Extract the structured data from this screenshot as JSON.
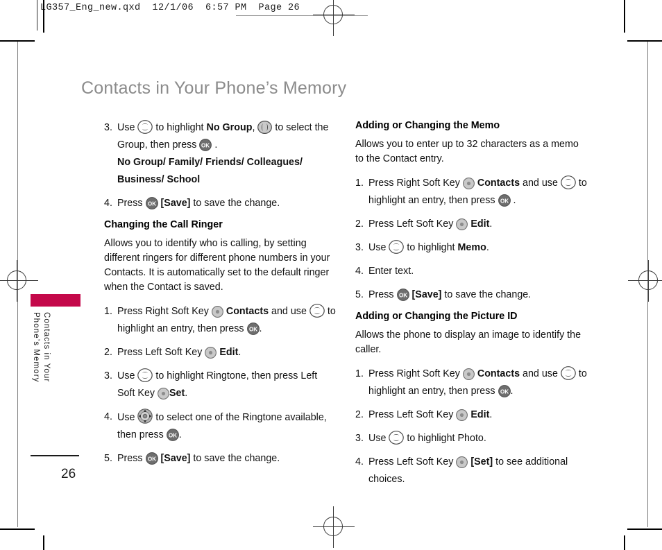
{
  "prepress": {
    "header_line": "LG357_Eng_new.qxd  12/1/06  6:57 PM  Page 26"
  },
  "page": {
    "title": "Contacts in Your Phone’s Memory",
    "side_tab_label": "Contacts in Your\nPhone’s Memory",
    "number": "26",
    "accent_color": "#c4084a"
  },
  "left_column": {
    "steps_group_continued": [
      {
        "num": "3.",
        "segments": [
          {
            "type": "text",
            "value": "Use "
          },
          {
            "type": "icon",
            "value": "updown-nav-icon"
          },
          {
            "type": "text",
            "value": " to highlight "
          },
          {
            "type": "bold",
            "value": "No Group"
          },
          {
            "type": "text",
            "value": ", "
          },
          {
            "type": "icon",
            "value": "leftright-nav-icon"
          },
          {
            "type": "text",
            "value": " to select the Group, then press "
          },
          {
            "type": "icon",
            "value": "ok-key-icon"
          },
          {
            "type": "text",
            "value": " ."
          }
        ],
        "sub_lines": [
          "No Group/ Family/ Friends/ Colleagues/",
          "Business/ School"
        ]
      },
      {
        "num": "4.",
        "segments": [
          {
            "type": "text",
            "value": "Press "
          },
          {
            "type": "icon",
            "value": "ok-key-icon"
          },
          {
            "type": "text",
            "value": " "
          },
          {
            "type": "bold",
            "value": "[Save]"
          },
          {
            "type": "text",
            "value": " to save the change."
          }
        ]
      }
    ],
    "section": {
      "heading": "Changing the Call Ringer",
      "paragraph": "Allows you to identify who is calling, by setting different ringers for different phone numbers in your Contacts. It is automatically set to the default ringer when the Contact is saved.",
      "steps": [
        {
          "num": "1.",
          "segments": [
            {
              "type": "text",
              "value": "Press Right Soft Key "
            },
            {
              "type": "icon",
              "value": "soft-key-icon"
            },
            {
              "type": "text",
              "value": " "
            },
            {
              "type": "bold",
              "value": "Contacts"
            },
            {
              "type": "text",
              "value": " and use "
            },
            {
              "type": "icon",
              "value": "updown-nav-icon"
            },
            {
              "type": "text",
              "value": " to highlight an entry, then press "
            },
            {
              "type": "icon",
              "value": "ok-key-icon"
            },
            {
              "type": "text",
              "value": "."
            }
          ]
        },
        {
          "num": "2.",
          "segments": [
            {
              "type": "text",
              "value": "Press Left Soft Key "
            },
            {
              "type": "icon",
              "value": "soft-key-icon"
            },
            {
              "type": "text",
              "value": " "
            },
            {
              "type": "bold",
              "value": "Edit"
            },
            {
              "type": "text",
              "value": "."
            }
          ]
        },
        {
          "num": "3.",
          "segments": [
            {
              "type": "text",
              "value": "Use "
            },
            {
              "type": "icon",
              "value": "updown-nav-icon"
            },
            {
              "type": "text",
              "value": " to highlight Ringtone, then press Left Soft Key "
            },
            {
              "type": "icon",
              "value": "soft-key-icon"
            },
            {
              "type": "bold",
              "value": "Set"
            },
            {
              "type": "text",
              "value": "."
            }
          ]
        },
        {
          "num": "4.",
          "segments": [
            {
              "type": "text",
              "value": "Use "
            },
            {
              "type": "icon",
              "value": "fourway-nav-icon"
            },
            {
              "type": "text",
              "value": " to select one of the Ringtone available, then press "
            },
            {
              "type": "icon",
              "value": "ok-key-icon"
            },
            {
              "type": "text",
              "value": "."
            }
          ]
        },
        {
          "num": "5.",
          "segments": [
            {
              "type": "text",
              "value": "Press "
            },
            {
              "type": "icon",
              "value": "ok-key-icon"
            },
            {
              "type": "text",
              "value": " "
            },
            {
              "type": "bold",
              "value": "[Save]"
            },
            {
              "type": "text",
              "value": " to save the change."
            }
          ]
        }
      ]
    }
  },
  "right_column": {
    "sections": [
      {
        "heading": "Adding or Changing the Memo",
        "paragraph": "Allows you to enter up to 32 characters as a memo to the Contact entry.",
        "steps": [
          {
            "num": "1.",
            "segments": [
              {
                "type": "text",
                "value": "Press Right Soft Key "
              },
              {
                "type": "icon",
                "value": "soft-key-icon"
              },
              {
                "type": "text",
                "value": " "
              },
              {
                "type": "bold",
                "value": "Contacts"
              },
              {
                "type": "text",
                "value": " and use "
              },
              {
                "type": "icon",
                "value": "updown-nav-icon"
              },
              {
                "type": "text",
                "value": " to highlight an entry, then press "
              },
              {
                "type": "icon",
                "value": "ok-key-icon"
              },
              {
                "type": "text",
                "value": " ."
              }
            ]
          },
          {
            "num": "2.",
            "segments": [
              {
                "type": "text",
                "value": "Press Left Soft Key "
              },
              {
                "type": "icon",
                "value": "soft-key-icon"
              },
              {
                "type": "text",
                "value": " "
              },
              {
                "type": "bold",
                "value": "Edit"
              },
              {
                "type": "text",
                "value": "."
              }
            ]
          },
          {
            "num": "3.",
            "segments": [
              {
                "type": "text",
                "value": "Use "
              },
              {
                "type": "icon",
                "value": "updown-nav-icon"
              },
              {
                "type": "text",
                "value": " to highlight "
              },
              {
                "type": "bold",
                "value": "Memo"
              },
              {
                "type": "text",
                "value": "."
              }
            ]
          },
          {
            "num": "4.",
            "segments": [
              {
                "type": "text",
                "value": "Enter text."
              }
            ]
          },
          {
            "num": "5.",
            "segments": [
              {
                "type": "text",
                "value": "Press "
              },
              {
                "type": "icon",
                "value": "ok-key-icon"
              },
              {
                "type": "text",
                "value": " "
              },
              {
                "type": "bold",
                "value": "[Save]"
              },
              {
                "type": "text",
                "value": " to save the change."
              }
            ]
          }
        ]
      },
      {
        "heading": "Adding or Changing the Picture ID",
        "paragraph": "Allows the phone to display an image to identify the caller.",
        "steps": [
          {
            "num": "1.",
            "segments": [
              {
                "type": "text",
                "value": "Press Right Soft Key "
              },
              {
                "type": "icon",
                "value": "soft-key-icon"
              },
              {
                "type": "text",
                "value": " "
              },
              {
                "type": "bold",
                "value": "Contacts"
              },
              {
                "type": "text",
                "value": " and use "
              },
              {
                "type": "icon",
                "value": "updown-nav-icon"
              },
              {
                "type": "text",
                "value": " to highlight an entry, then press "
              },
              {
                "type": "icon",
                "value": "ok-key-icon"
              },
              {
                "type": "text",
                "value": "."
              }
            ]
          },
          {
            "num": "2.",
            "segments": [
              {
                "type": "text",
                "value": "Press Left Soft Key "
              },
              {
                "type": "icon",
                "value": "soft-key-icon"
              },
              {
                "type": "text",
                "value": " "
              },
              {
                "type": "bold",
                "value": "Edit"
              },
              {
                "type": "text",
                "value": "."
              }
            ]
          },
          {
            "num": "3.",
            "segments": [
              {
                "type": "text",
                "value": "Use "
              },
              {
                "type": "icon",
                "value": "updown-nav-icon"
              },
              {
                "type": "text",
                "value": " to highlight Photo."
              }
            ]
          },
          {
            "num": "4.",
            "segments": [
              {
                "type": "text",
                "value": "Press Left Soft Key "
              },
              {
                "type": "icon",
                "value": "soft-key-icon"
              },
              {
                "type": "text",
                "value": " "
              },
              {
                "type": "bold",
                "value": "[Set]"
              },
              {
                "type": "text",
                "value": " to see additional choices."
              }
            ]
          }
        ]
      }
    ]
  }
}
